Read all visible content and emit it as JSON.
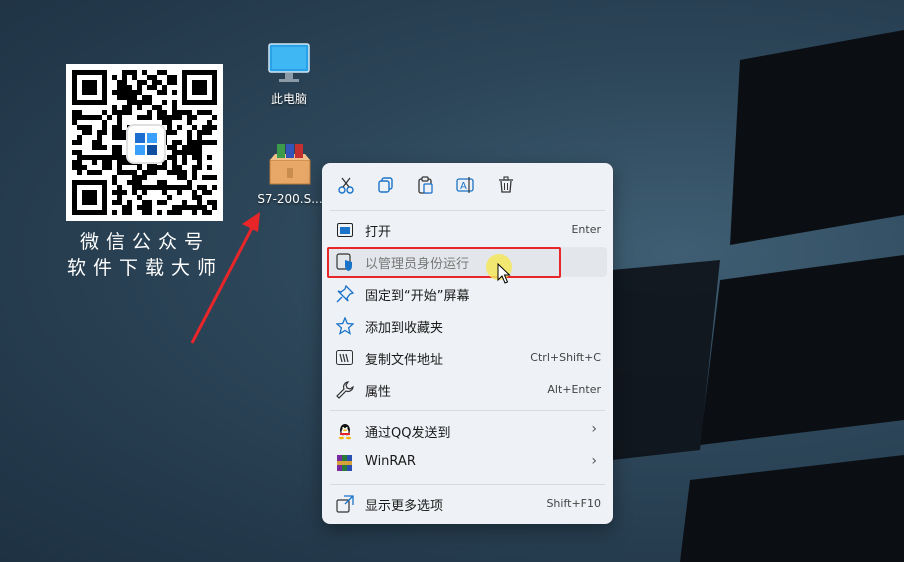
{
  "desktop": {
    "icons": [
      {
        "label": "此电脑",
        "icon": "monitor-icon"
      },
      {
        "label": "S7-200.S...",
        "icon": "winrar-archive-icon"
      }
    ],
    "qr_caption_line1": "微信公众号",
    "qr_caption_line2": "软件下载大师",
    "qr_center_logo": "logo-icon"
  },
  "context_menu": {
    "toolbar": [
      {
        "name": "cut",
        "icon": "scissors-icon"
      },
      {
        "name": "copy",
        "icon": "copy-icon"
      },
      {
        "name": "paste",
        "icon": "paste-icon"
      },
      {
        "name": "rename",
        "icon": "rename-icon"
      },
      {
        "name": "delete",
        "icon": "trash-icon"
      }
    ],
    "items": [
      {
        "label": "打开",
        "shortcut": "Enter",
        "icon": "open-window-icon"
      },
      {
        "label": "以管理员身份运行",
        "shortcut": "",
        "icon": "shield-icon",
        "state": "hovered"
      },
      {
        "label": "固定到“开始”屏幕",
        "shortcut": "",
        "icon": "pin-icon"
      },
      {
        "label": "添加到收藏夹",
        "shortcut": "",
        "icon": "star-icon"
      },
      {
        "label": "复制文件地址",
        "shortcut": "Ctrl+Shift+C",
        "icon": "copy-path-icon"
      },
      {
        "label": "属性",
        "shortcut": "Alt+Enter",
        "icon": "wrench-icon"
      },
      {
        "label": "通过QQ发送到",
        "shortcut": "",
        "icon": "qq-penguin-icon",
        "submenu": true
      },
      {
        "label": "WinRAR",
        "shortcut": "",
        "icon": "winrar-icon",
        "submenu": true
      },
      {
        "label": "显示更多选项",
        "shortcut": "Shift+F10",
        "icon": "more-options-icon"
      }
    ]
  },
  "colors": {
    "highlight_border": "#e8262a",
    "arrow": "#e8262a",
    "accent": "#1a73c9"
  }
}
